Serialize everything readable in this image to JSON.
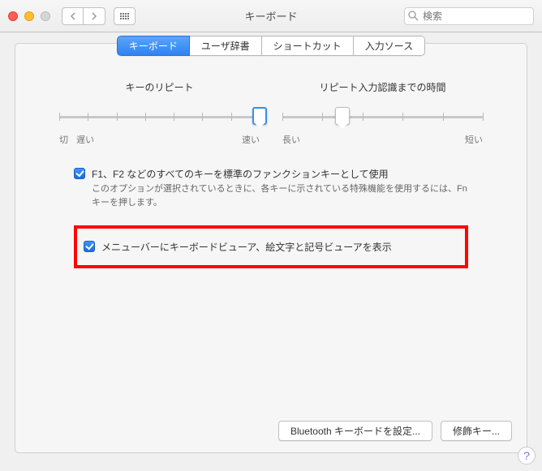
{
  "titlebar": {
    "title": "キーボード",
    "search_placeholder": "検索"
  },
  "tabs": {
    "items": [
      "キーボード",
      "ユーザ辞書",
      "ショートカット",
      "入力ソース"
    ],
    "active_index": 0
  },
  "sliders": {
    "left": {
      "title": "キーのリピート",
      "min_label": "切",
      "min2_label": "遅い",
      "max_label": "速い",
      "thumb_pct": 100,
      "ticks": 8
    },
    "right": {
      "title": "リピート入力認識までの時間",
      "min_label": "長い",
      "max_label": "短い",
      "thumb_pct": 30,
      "ticks": 6
    }
  },
  "checks": {
    "fn": {
      "label": "F1、F2 などのすべてのキーを標準のファンクションキーとして使用",
      "desc": "このオプションが選択されているときに、各キーに示されている特殊機能を使用するには、Fn キーを押します。",
      "checked": true
    },
    "viewer": {
      "label": "メニューバーにキーボードビューア、絵文字と記号ビューアを表示",
      "checked": true
    }
  },
  "footer": {
    "bluetooth": "Bluetooth キーボードを設定...",
    "modifier": "修飾キー..."
  }
}
